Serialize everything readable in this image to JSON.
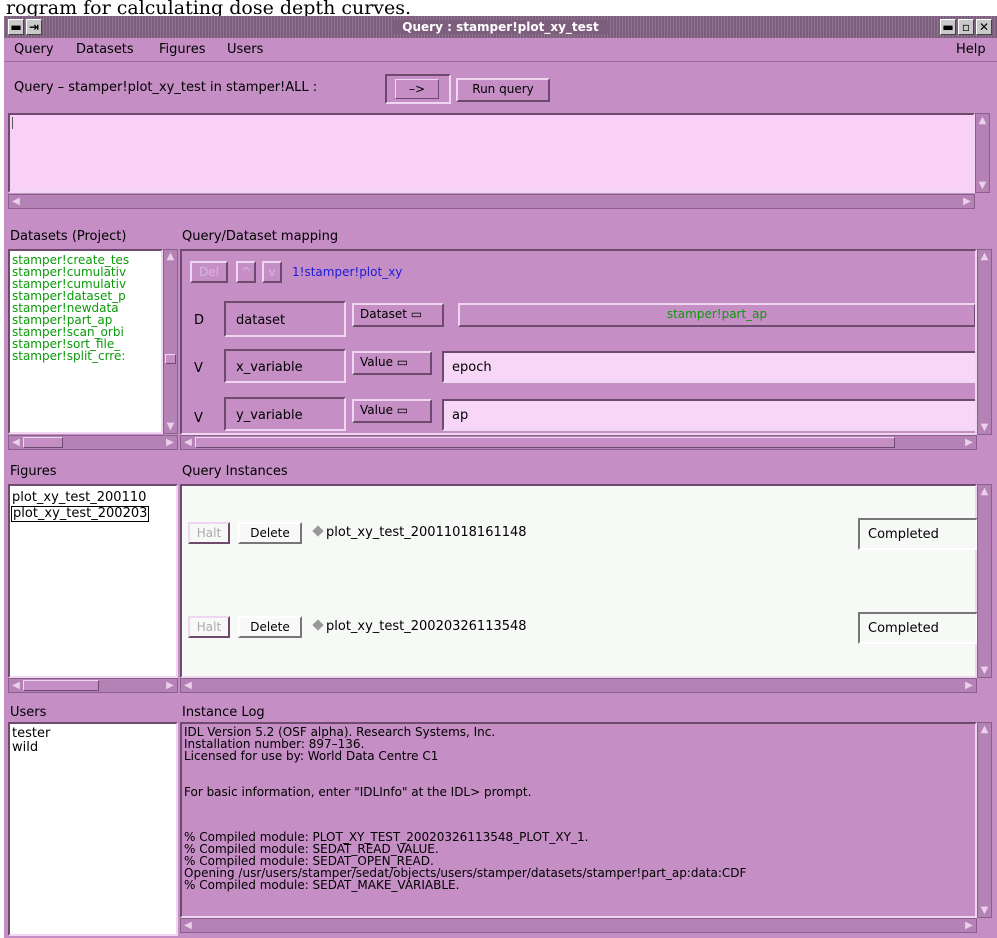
{
  "caption": "rogram for calculating dose depth curves.",
  "window": {
    "title": "Query : stamper!plot_xy_test",
    "controls": [
      "▬",
      "▫",
      "✕"
    ]
  },
  "menu": {
    "items": [
      "Query",
      "Datasets",
      "Figures",
      "Users"
    ],
    "help": "Help"
  },
  "query": {
    "label": "Query – stamper!plot_xy_test in stamper!ALL :",
    "arrow": "–>",
    "run_label": "Run query",
    "text": ""
  },
  "datasets": {
    "header": "Datasets (Project)",
    "items": [
      "stamper!create_tes",
      "stamper!cumulativ",
      "stamper!cumulativ",
      "stamper!dataset_p",
      "stamper!newdata",
      "stamper!part_ap",
      "stamper!scan_orbi",
      "stamper!sort_file_",
      "stamper!split_crre:"
    ]
  },
  "mapping": {
    "header": "Query/Dataset mapping",
    "del_label": "Del",
    "up_label": "^",
    "down_label": "v",
    "target": "1!stamper!plot_xy",
    "rows": [
      {
        "kind": "D",
        "name": "dataset",
        "type": "Dataset ▭",
        "value": "stamper!part_ap"
      },
      {
        "kind": "V",
        "name": "x_variable",
        "type": "Value ▭",
        "value": "epoch"
      },
      {
        "kind": "V",
        "name": "y_variable",
        "type": "Value ▭",
        "value": "ap"
      }
    ]
  },
  "figures": {
    "header": "Figures",
    "items": [
      "plot_xy_test_200110",
      "plot_xy_test_200203"
    ]
  },
  "instances": {
    "header": "Query Instances",
    "halt_label": "Halt",
    "delete_label": "Delete",
    "items": [
      {
        "name": "plot_xy_test_20011018161148",
        "status": "Completed"
      },
      {
        "name": "plot_xy_test_20020326113548",
        "status": "Completed"
      }
    ]
  },
  "users": {
    "header": "Users",
    "items": [
      "tester",
      "wild"
    ]
  },
  "log": {
    "header": "Instance Log",
    "lines": [
      "IDL Version 5.2 (OSF alpha). Research Systems, Inc.",
      "Installation number: 897–136.",
      "Licensed for use by: World Data Centre C1",
      "",
      "For basic information, enter \"IDLInfo\" at the IDL> prompt.",
      "",
      "% Compiled module: PLOT_XY_TEST_20020326113548_PLOT_XY_1.",
      "% Compiled module: SEDAT_READ_VALUE.",
      "% Compiled module: SEDAT_OPEN_READ.",
      "Opening /usr/users/stamper/sedat/objects/users/stamper/datasets/stamper!part_ap:data:CDF",
      "% Compiled module: SEDAT_MAKE_VARIABLE."
    ]
  },
  "icons": {
    "up": "▲",
    "down": "▼",
    "left": "◀",
    "right": "▶"
  },
  "colors": {
    "window_bg": "#c58ec5",
    "field_bg": "#f8d0f8",
    "green_text": "#0b9a0b",
    "blue_text": "#1b1bd8"
  }
}
